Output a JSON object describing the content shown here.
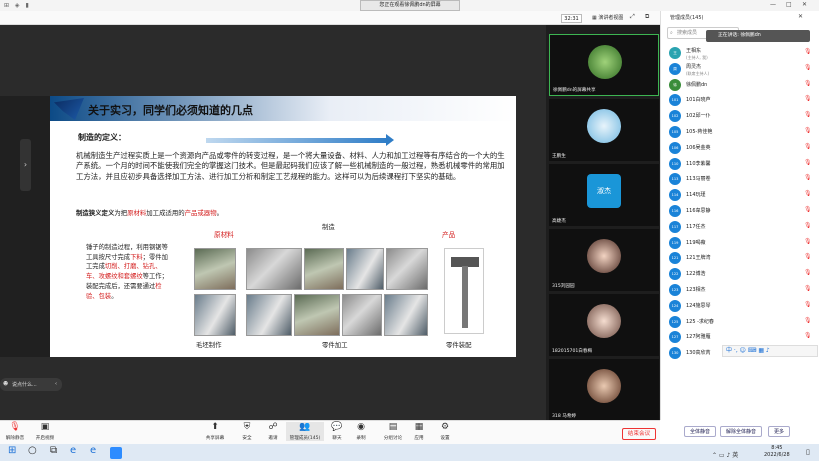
{
  "window": {
    "title": "您正在观看徐佩鹏dn的屏幕",
    "meeting_id": "32:31",
    "view_button": "演讲者视图"
  },
  "slide": {
    "title": "关于实习，同学们必须知道的几点",
    "subtitle": "制造的定义：",
    "paragraph": "机械制造生产过程实质上是一个资源向产品或零件的转变过程，是一个将大量设备、材料、人力和加工过程等有序结合的一个大的生产系统。一个月的时间不能使我们完全的掌握这门技术。但是最起码我们应该了解一些机械制造的一般过程，熟悉机械零件的常用加工方法，并且应初步具备选择加工方法、进行加工分析和制定工艺规程的能力。这样可以为后续课程打下坚实的基础。",
    "def_prefix": "制造狭义定义",
    "def_mid1": "为把",
    "def_red1": "原材料",
    "def_mid2": "加工成适用的",
    "def_red2": "产品或器物",
    "def_end": "。",
    "flow_left": "原材料",
    "flow_mid": "制造",
    "flow_right": "产品",
    "left_text_1": "锤子的制造过程，利用钢锯等工具按尺寸完成",
    "left_red_1": "下料",
    "left_text_2": "；零件加工完成",
    "left_red_2": "切削、打磨、钻孔、车、攻螺纹和套螺纹",
    "left_text_3": "等工作；装配完成后，还需要通过",
    "left_red_3": "检验、包装",
    "left_text_4": "。",
    "cap_blank": "毛坯制作",
    "cap_parts": "零件加工",
    "cap_assembly": "零件装配"
  },
  "chat_pill": "说点什么...",
  "videos": [
    {
      "name": "徐佩鹏dn的屏幕共享",
      "active": true
    },
    {
      "name": "王鹏生",
      "active": false
    },
    {
      "name": "高婕杰",
      "active": false,
      "badge": "淑杰"
    },
    {
      "name": "315刘园园",
      "active": false
    },
    {
      "name": "182015701白春梅",
      "active": false
    },
    {
      "name": "318 马希婷",
      "active": false
    }
  ],
  "panel": {
    "title": "管理成员(145)",
    "search_placeholder": "搜索成员",
    "speaking": "正在讲话: 徐佩鹏dn",
    "members": [
      {
        "name": "王相东",
        "sub": "(主持人, 我)",
        "av": "王"
      },
      {
        "name": "周灵杰",
        "sub": "(联席主持人)",
        "av": "周"
      },
      {
        "name": "徐佩鹏dn",
        "sub": "",
        "av": "徐"
      },
      {
        "name": "101白晓芦",
        "sub": "",
        "av": "101"
      },
      {
        "name": "102邱一仆",
        "sub": "",
        "av": "102"
      },
      {
        "name": "105-蒋佳艳",
        "sub": "",
        "av": "105"
      },
      {
        "name": "106吴金英",
        "sub": "",
        "av": "106"
      },
      {
        "name": "110李紫馨",
        "sub": "",
        "av": "110"
      },
      {
        "name": "113马丽卷",
        "sub": "",
        "av": "113"
      },
      {
        "name": "114玩瑾",
        "sub": "",
        "av": "114"
      },
      {
        "name": "116韋思静",
        "sub": "",
        "av": "116"
      },
      {
        "name": "117任杰",
        "sub": "",
        "av": "117"
      },
      {
        "name": "119喝薇",
        "sub": "",
        "av": "119"
      },
      {
        "name": "121王牌湾",
        "sub": "",
        "av": "121"
      },
      {
        "name": "122博浩",
        "sub": "",
        "av": "122"
      },
      {
        "name": "123相杰",
        "sub": "",
        "av": "123"
      },
      {
        "name": "124施思琴",
        "sub": "",
        "av": "124"
      },
      {
        "name": "125 -求纪春",
        "sub": "",
        "av": "125"
      },
      {
        "name": "127阿雅雁",
        "sub": "",
        "av": "127"
      },
      {
        "name": "130高欣芮",
        "sub": "",
        "av": "130"
      }
    ],
    "btn_mute_all": "全体静音",
    "btn_unmute_all": "解除全体静音",
    "btn_more": "更多"
  },
  "ime": "中 ·, ☺ ⌨ ▦ ♪",
  "toolbar": {
    "unmute": "解除静音",
    "video": "开启视频",
    "share": "共享屏幕",
    "security": "安全",
    "record_note": "邀请",
    "members": "管理成员(145)",
    "chat": "聊天",
    "record": "录制",
    "breakout": "分组讨论",
    "apps": "应用",
    "settings": "设置",
    "end": "结束会议"
  },
  "clock": {
    "time": "8:45",
    "date": "2022/6/28"
  }
}
